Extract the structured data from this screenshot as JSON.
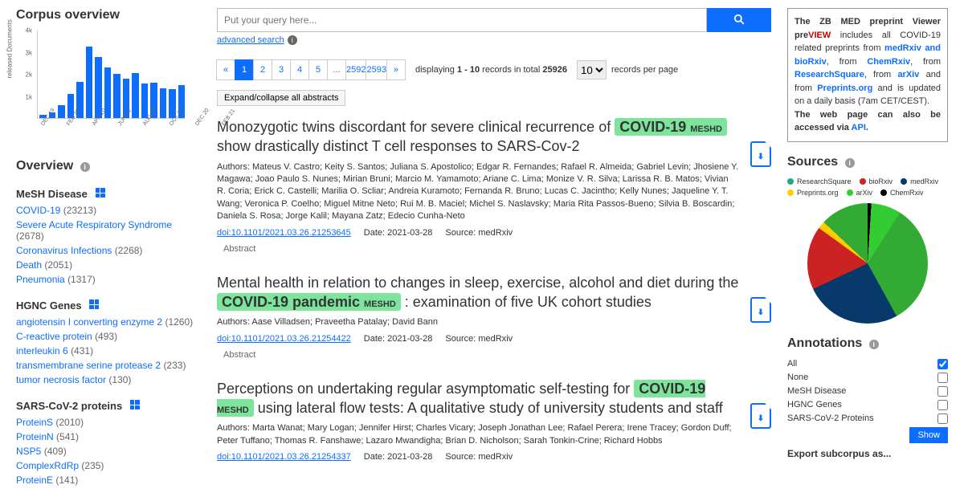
{
  "left": {
    "corpus_heading": "Corpus overview",
    "overview_heading": "Overview",
    "facets": [
      {
        "heading": "MeSH Disease",
        "items": [
          {
            "label": "COVID-19",
            "count": "(23213)"
          },
          {
            "label": "Severe Acute Respiratory Syndrome",
            "count": "(2678)"
          },
          {
            "label": "Coronavirus Infections",
            "count": "(2268)"
          },
          {
            "label": "Death",
            "count": "(2051)"
          },
          {
            "label": "Pneumonia",
            "count": "(1317)"
          }
        ]
      },
      {
        "heading": "HGNC Genes",
        "items": [
          {
            "label": "angiotensin I converting enzyme 2",
            "count": "(1260)"
          },
          {
            "label": "C-reactive protein",
            "count": "(493)"
          },
          {
            "label": "interleukin 6",
            "count": "(431)"
          },
          {
            "label": "transmembrane serine protease 2",
            "count": "(233)"
          },
          {
            "label": "tumor necrosis factor",
            "count": "(130)"
          }
        ]
      },
      {
        "heading": "SARS-CoV-2 proteins",
        "items": [
          {
            "label": "ProteinS",
            "count": "(2010)"
          },
          {
            "label": "ProteinN",
            "count": "(541)"
          },
          {
            "label": "NSP5",
            "count": "(409)"
          },
          {
            "label": "ComplexRdRp",
            "count": "(235)"
          },
          {
            "label": "ProteinE",
            "count": "(141)"
          }
        ]
      }
    ]
  },
  "chart_data": {
    "type": "bar",
    "ylabel": "released Documents",
    "yticks": [
      "1k",
      "2k",
      "3k",
      "4k"
    ],
    "ymax": 4000,
    "categories": [
      "DEC 19",
      "FEB 20",
      "APR 20",
      "JUN 20",
      "AUG 20",
      "OCT 20",
      "DEC 20",
      "FEB 21"
    ],
    "values": [
      150,
      250,
      600,
      1100,
      1650,
      3250,
      2750,
      2300,
      2000,
      1800,
      2050,
      1550,
      1600,
      1350,
      1300,
      1500
    ]
  },
  "search": {
    "placeholder": "Put your query here...",
    "advanced": "advanced search",
    "pages": [
      "«",
      "1",
      "2",
      "3",
      "4",
      "5",
      "...",
      "2592",
      "2593",
      "»"
    ],
    "active_page": "1",
    "display_text_pre": "displaying ",
    "display_range": "1 - 10",
    "display_text_mid": " records in total ",
    "total": "25926",
    "rpp_value": "10",
    "rpp_label": "records per page",
    "expand": "Expand/collapse all abstracts"
  },
  "articles": [
    {
      "title_pre": "Monozygotic twins discordant for severe clinical recurrence of ",
      "tag": "COVID-19",
      "tag_sub": "MESHD",
      "title_post": " show drastically distinct T cell responses to SARS-Cov-2",
      "authors": "Authors: Mateus V. Castro; Keity S. Santos; Juliana S. Apostolico; Edgar R. Fernandes; Rafael R. Almeida; Gabriel Levin; Jhosiene Y. Magawa; Joao Paulo S. Nunes; Mirian Bruni; Marcio M. Yamamoto; Ariane C. Lima; Monize V. R. Silva; Larissa R. B. Matos; Vivian R. Coria; Erick C. Castelli; Marilia O. Scliar; Andreia Kuramoto; Fernanda R. Bruno; Lucas C. Jacintho; Kelly Nunes; Jaqueline Y. T. Wang; Veronica P. Coelho; Miguel Mitne Neto; Rui M. B. Maciel; Michel S. Naslavsky; Maria Rita Passos-Bueno; Silvia B. Boscardin; Daniela S. Rosa; Jorge Kalil; Mayana Zatz; Edecio Cunha-Neto",
      "doi": "doi:10.1101/2021.03.26.21253645",
      "date": "Date: 2021-03-28",
      "source": "Source: medRxiv",
      "abstract": "Abstract"
    },
    {
      "title_pre": "Mental health in relation to changes in sleep, exercise, alcohol and diet during the ",
      "tag": "COVID-19 pandemic",
      "tag_sub": "MESHD",
      "title_post": " : examination of five UK cohort studies",
      "authors": "Authors: Aase Villadsen; Praveetha Patalay; David Bann",
      "doi": "doi:10.1101/2021.03.26.21254422",
      "date": "Date: 2021-03-28",
      "source": "Source: medRxiv",
      "abstract": "Abstract"
    },
    {
      "title_pre": "Perceptions on undertaking regular asymptomatic self-testing for ",
      "tag": "COVID-19",
      "tag_sub": "MESHD",
      "title_post": " using lateral flow tests: A qualitative study of university students and staff",
      "authors": "Authors: Marta Wanat; Mary Logan; Jennifer Hirst; Charles Vicary; Joseph Jonathan Lee; Rafael Perera; Irene Tracey; Gordon Duff; Peter Tuffano; Thomas R. Fanshawe; Lazaro Mwandigha; Brian D. Nicholson; Sarah Tonkin-Crine; Richard Hobbs",
      "doi": "doi:10.1101/2021.03.26.21254337",
      "date": "Date: 2021-03-28",
      "source": "Source: medRxiv",
      "abstract": ""
    }
  ],
  "right": {
    "info_p1a": "The ZB MED preprint Viewer pre",
    "info_p1b": "VIEW",
    "info_p1c": " includes all COVID-19 related preprints from ",
    "links": {
      "medbio": "medRxiv and bioRxiv",
      "chem": "ChemRxiv",
      "rs": "ResearchSquare",
      "arxiv": "arXiv",
      "pp": "Preprints.org",
      "api": "API"
    },
    "info_seg_from1": ", from ",
    "info_seg_from2": ", from ",
    "info_seg_and": " and from ",
    "info_seg_upd": " and is updated on a daily basis (7am CET/CEST).",
    "info_p2": "The web page can also be accessed via ",
    "sources_heading": "Sources",
    "legend": [
      {
        "c": "#2a8",
        "t": "ResearchSquare"
      },
      {
        "c": "#c22",
        "t": "bioRxiv"
      },
      {
        "c": "#07396b",
        "t": "medRxiv"
      },
      {
        "c": "#fc0",
        "t": "Preprints.org"
      },
      {
        "c": "#3c3",
        "t": "arXiv"
      },
      {
        "c": "#000",
        "t": "ChemRxiv"
      }
    ],
    "annotations_heading": "Annotations",
    "ann": [
      "All",
      "None",
      "MeSH Disease",
      "HGNC Genes",
      "SARS-CoV-2 Proteins"
    ],
    "show": "Show",
    "export": "Export subcorpus as..."
  }
}
